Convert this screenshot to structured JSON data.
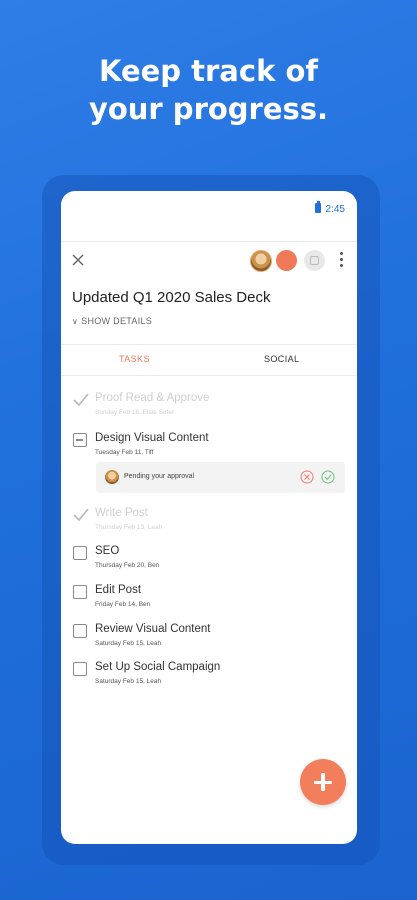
{
  "headline": {
    "line1": "Keep track of",
    "line2": "your progress."
  },
  "statusbar": {
    "time": "2:45"
  },
  "project": {
    "title": "Updated Q1 2020 Sales Deck",
    "show_details": "SHOW DETAILS"
  },
  "tabs": [
    {
      "label": "TASKS",
      "active": true
    },
    {
      "label": "SOCIAL",
      "active": false
    }
  ],
  "tasks": [
    {
      "name": "Proof Read & Approve",
      "meta": "Sunday Feb 16, Elsie Sofer",
      "state": "done"
    },
    {
      "name": "Design Visual Content",
      "meta": "Tuesday Feb 11, Tiff",
      "state": "pending"
    },
    {
      "name": "Write Post",
      "meta": "Thursday Feb 13, Leah",
      "state": "done"
    },
    {
      "name": "SEO",
      "meta": "Thursday Feb 20, Ben",
      "state": "open"
    },
    {
      "name": "Edit Post",
      "meta": "Friday Feb 14, Ben",
      "state": "open"
    },
    {
      "name": "Review Visual Content",
      "meta": "Saturday Feb 15, Leah",
      "state": "open"
    },
    {
      "name": "Set Up Social Campaign",
      "meta": "Saturday Feb 15, Leah",
      "state": "open"
    }
  ],
  "approval": {
    "text": "Pending your approval"
  },
  "colors": {
    "accent": "#f0795a",
    "brand_blue": "#1f6fdc",
    "approve_green": "#6cc27a",
    "reject_red": "#f07a7a"
  },
  "icons": [
    "close-icon",
    "more-icon",
    "checkmark-icon",
    "reject-icon",
    "approve-icon",
    "plus-icon",
    "battery-icon"
  ]
}
